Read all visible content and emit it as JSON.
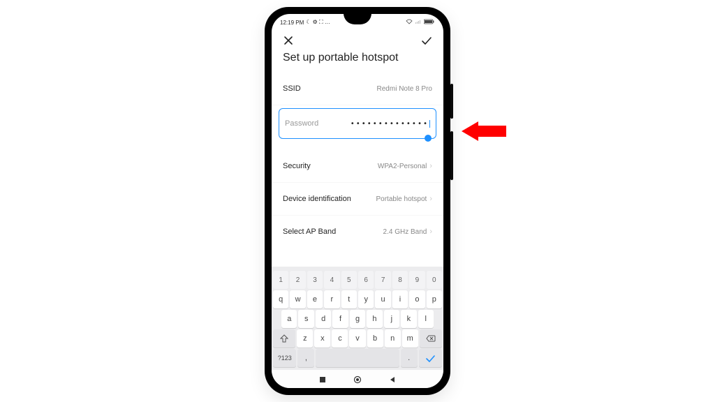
{
  "status_bar": {
    "time": "12:19 PM",
    "icons_left": "☾ ⚙ ⛶ …",
    "icons_right": "⌔ 📶 🔋"
  },
  "header": {
    "title": "Set up portable hotspot"
  },
  "rows": {
    "ssid_label": "SSID",
    "ssid_value": "Redmi Note 8 Pro",
    "password_label": "Password",
    "password_value": "••••••••••••••",
    "security_label": "Security",
    "security_value": "WPA2-Personal",
    "device_id_label": "Device identification",
    "device_id_value": "Portable hotspot",
    "ap_band_label": "Select AP Band",
    "ap_band_value": "2.4 GHz Band"
  },
  "keyboard": {
    "row_num": [
      "1",
      "2",
      "3",
      "4",
      "5",
      "6",
      "7",
      "8",
      "9",
      "0"
    ],
    "row1": [
      "q",
      "w",
      "e",
      "r",
      "t",
      "y",
      "u",
      "i",
      "o",
      "p"
    ],
    "row2": [
      "a",
      "s",
      "d",
      "f",
      "g",
      "h",
      "j",
      "k",
      "l"
    ],
    "row3": [
      "z",
      "x",
      "c",
      "v",
      "b",
      "n",
      "m"
    ],
    "alt_label": "?123",
    "comma": ",",
    "period": "."
  }
}
